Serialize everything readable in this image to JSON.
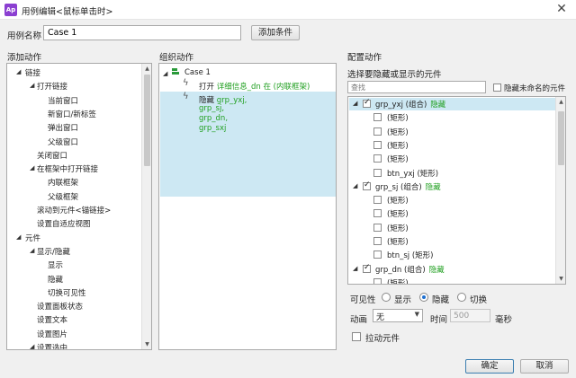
{
  "window": {
    "title": "用例编辑<鼠标单击时>",
    "app_icon": "Ap",
    "close_glyph": "✕"
  },
  "case": {
    "label": "用例名称",
    "value": "Case 1"
  },
  "add_condition_label": "添加条件",
  "columns": {
    "add_action": "添加动作",
    "organize_action": "组织动作",
    "configure_action": "配置动作"
  },
  "action_tree": [
    {
      "label": "链接",
      "level": 0,
      "expanded": true
    },
    {
      "label": "打开链接",
      "level": 1,
      "expanded": true
    },
    {
      "label": "当前窗口",
      "level": 2
    },
    {
      "label": "新窗口/新标签",
      "level": 2
    },
    {
      "label": "弹出窗口",
      "level": 2
    },
    {
      "label": "父级窗口",
      "level": 2
    },
    {
      "label": "关闭窗口",
      "level": 1
    },
    {
      "label": "在框架中打开链接",
      "level": 1,
      "expanded": true
    },
    {
      "label": "内联框架",
      "level": 2
    },
    {
      "label": "父级框架",
      "level": 2
    },
    {
      "label": "滚动到元件<锚链接>",
      "level": 1
    },
    {
      "label": "设置自适应视图",
      "level": 1
    },
    {
      "label": "元件",
      "level": 0,
      "expanded": true
    },
    {
      "label": "显示/隐藏",
      "level": 1,
      "expanded": true
    },
    {
      "label": "显示",
      "level": 2
    },
    {
      "label": "隐藏",
      "level": 2
    },
    {
      "label": "切换可见性",
      "level": 2
    },
    {
      "label": "设置面板状态",
      "level": 1
    },
    {
      "label": "设置文本",
      "level": 1
    },
    {
      "label": "设置图片",
      "level": 1
    },
    {
      "label": "设置选中",
      "level": 1,
      "expanded": true
    }
  ],
  "organize": {
    "case_name": "Case 1",
    "actions": [
      {
        "prefix": "打开",
        "detail": "详细信息_dn 在 (内联框架)"
      },
      {
        "prefix": "隐藏",
        "detail_lines": [
          "grp_yxj,",
          "grp_sj,",
          "grp_dn,",
          "grp_sxj"
        ]
      }
    ]
  },
  "config": {
    "select_label": "选择要隐藏或显示的元件",
    "search_placeholder": "查找",
    "hide_unnamed_label": "隐藏未命名的元件",
    "widgets": [
      {
        "name": "grp_yxj (组合)",
        "status": "隐藏",
        "checked": true,
        "group": true,
        "selected": true
      },
      {
        "name": "(矩形)",
        "checked": false
      },
      {
        "name": "(矩形)",
        "checked": false
      },
      {
        "name": "(矩形)",
        "checked": false
      },
      {
        "name": "(矩形)",
        "checked": false
      },
      {
        "name": "btn_yxj (矩形)",
        "checked": false
      },
      {
        "name": "grp_sj (组合)",
        "status": "隐藏",
        "checked": true,
        "group": true
      },
      {
        "name": "(矩形)",
        "checked": false
      },
      {
        "name": "(矩形)",
        "checked": false
      },
      {
        "name": "(矩形)",
        "checked": false
      },
      {
        "name": "(矩形)",
        "checked": false
      },
      {
        "name": "btn_sj (矩形)",
        "checked": false
      },
      {
        "name": "grp_dn (组合)",
        "status": "隐藏",
        "checked": true,
        "group": true
      },
      {
        "name": "(矩形)",
        "checked": false
      }
    ],
    "visibility_label": "可见性",
    "visibility_options": [
      {
        "label": "显示",
        "selected": false
      },
      {
        "label": "隐藏",
        "selected": true
      },
      {
        "label": "切换",
        "selected": false
      }
    ],
    "animation_label": "动画",
    "animation_value": "无",
    "time_label": "时间",
    "time_value": "500",
    "ms_label": "毫秒",
    "drag_label": "拉动元件"
  },
  "buttons": {
    "ok": "确定",
    "cancel": "取消"
  },
  "colors": {
    "status_green": "#22a022",
    "selection_blue": "#cde8f3",
    "app_icon": "#8b3fd1"
  }
}
